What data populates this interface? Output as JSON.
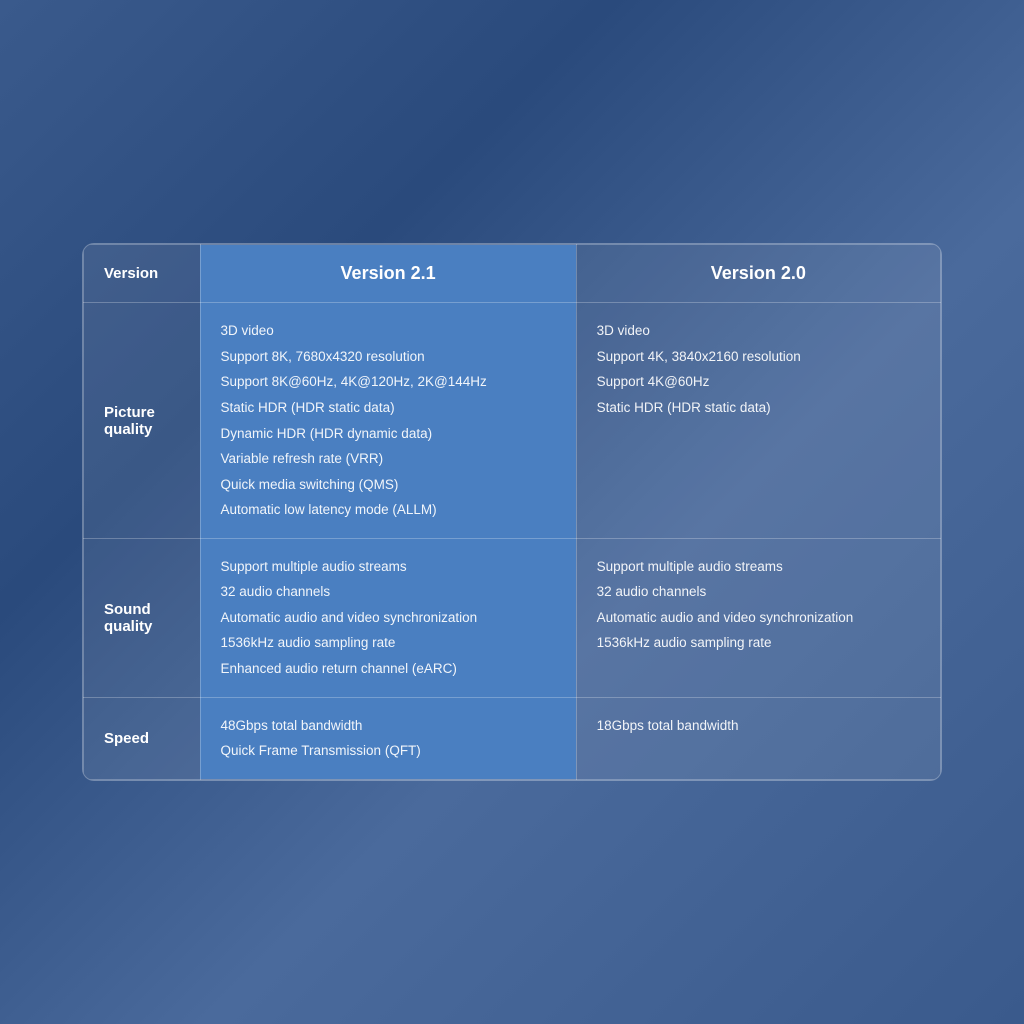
{
  "header": {
    "col_label": "Version",
    "col_v21": "Version 2.1",
    "col_v20": "Version 2.0"
  },
  "rows": [
    {
      "label": "Picture\nquality",
      "v21_features": [
        "3D video",
        "Support 8K, 7680x4320 resolution",
        "Support 8K@60Hz, 4K@120Hz, 2K@144Hz",
        "Static HDR (HDR static data)",
        "Dynamic HDR (HDR dynamic data)",
        "Variable refresh rate (VRR)",
        "Quick media switching (QMS)",
        "Automatic low latency mode (ALLM)"
      ],
      "v20_features": [
        "3D video",
        "Support 4K, 3840x2160 resolution",
        "Support 4K@60Hz",
        "Static HDR (HDR static data)"
      ]
    },
    {
      "label": "Sound\nquality",
      "v21_features": [
        "Support multiple audio streams",
        "32 audio channels",
        "Automatic audio and video synchronization",
        "1536kHz audio sampling rate",
        "Enhanced audio return channel (eARC)"
      ],
      "v20_features": [
        "Support multiple audio streams",
        "32 audio channels",
        "Automatic audio and video synchronization",
        "1536kHz audio sampling rate"
      ]
    },
    {
      "label": "Speed",
      "v21_features": [
        "48Gbps total bandwidth",
        "Quick Frame Transmission (QFT)"
      ],
      "v20_features": [
        "18Gbps total bandwidth"
      ]
    }
  ]
}
